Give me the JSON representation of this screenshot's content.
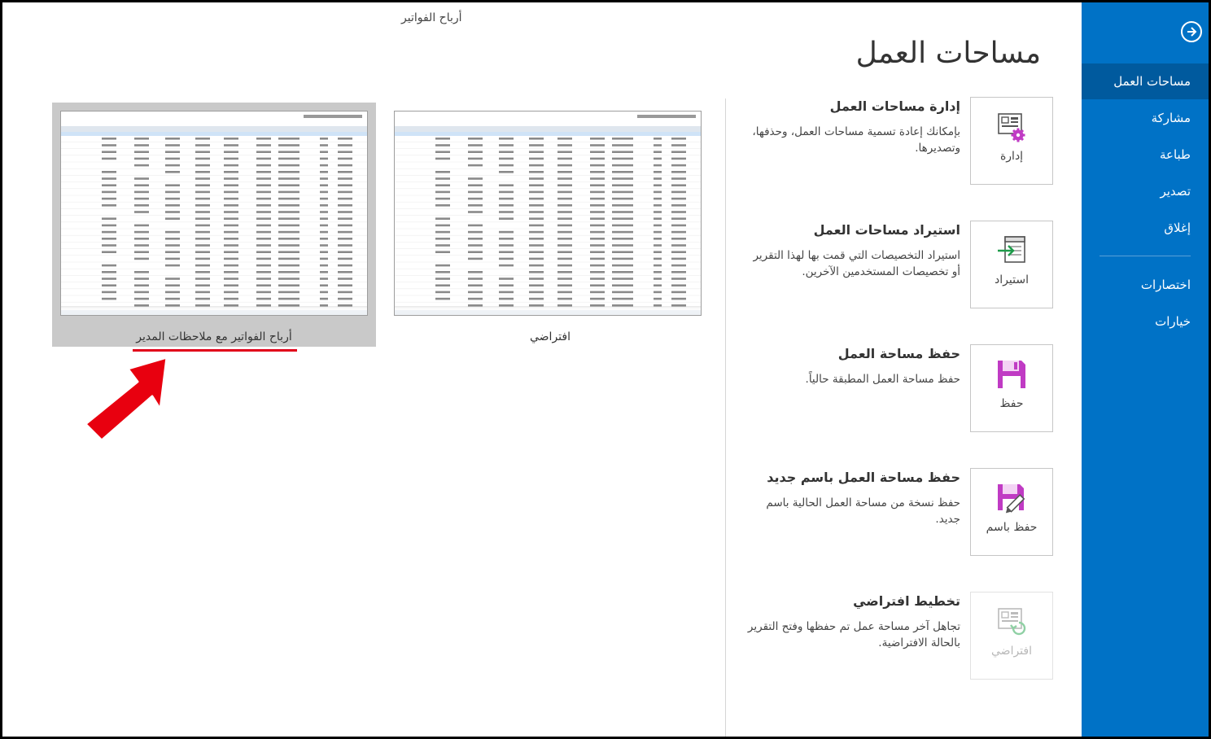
{
  "nav": {
    "back_icon": "back-arrow-icon",
    "items": [
      {
        "label": "مساحات العمل",
        "active": true
      },
      {
        "label": "مشاركة"
      },
      {
        "label": "طباعة"
      },
      {
        "label": "تصدير"
      },
      {
        "label": "إغلاق"
      },
      {
        "label": "اختصارات"
      },
      {
        "label": "خيارات"
      }
    ]
  },
  "main": {
    "title": "مساحات العمل",
    "document_title": "أرباح الفواتير",
    "commands": [
      {
        "button_label": "إدارة",
        "icon": "manage-layout-gear-icon",
        "heading": "إدارة مساحات العمل",
        "description": "بإمكانك إعادة تسمية مساحات العمل، وحذفها، وتصديرها."
      },
      {
        "button_label": "استيراد",
        "icon": "import-arrow-icon",
        "heading": "استيراد مساحات العمل",
        "description": "استيراد التخصيصات التي قمت بها لهذا التقرير أو تخصيصات المستخدمين الآخرين."
      },
      {
        "button_label": "حفظ",
        "icon": "save-disk-icon",
        "heading": "حفظ مساحة العمل",
        "description": "حفظ مساحة العمل المطبقة حالياً."
      },
      {
        "button_label": "حفظ باسم",
        "icon": "save-as-pencil-icon",
        "heading": "حفظ مساحة العمل باسم جديد",
        "description": "حفظ نسخة من مساحة العمل الحالية باسم جديد."
      },
      {
        "button_label": "افتراضي",
        "icon": "default-layout-reset-icon",
        "heading": "تخطيط افتراضي",
        "description": "تجاهل آخر مساحة عمل تم حفظها وفتح التقرير بالحالة الافتراضية.",
        "disabled": true
      }
    ],
    "workspaces": [
      {
        "caption": "افتراضي",
        "selected": false
      },
      {
        "caption": "أرباح الفواتير مع ملاحظات المدير",
        "selected": true
      }
    ]
  },
  "colors": {
    "nav_bg": "#0072c6",
    "nav_active": "#005a9e",
    "icon_purple": "#c03bc4",
    "annotation_red": "#e1001a"
  }
}
